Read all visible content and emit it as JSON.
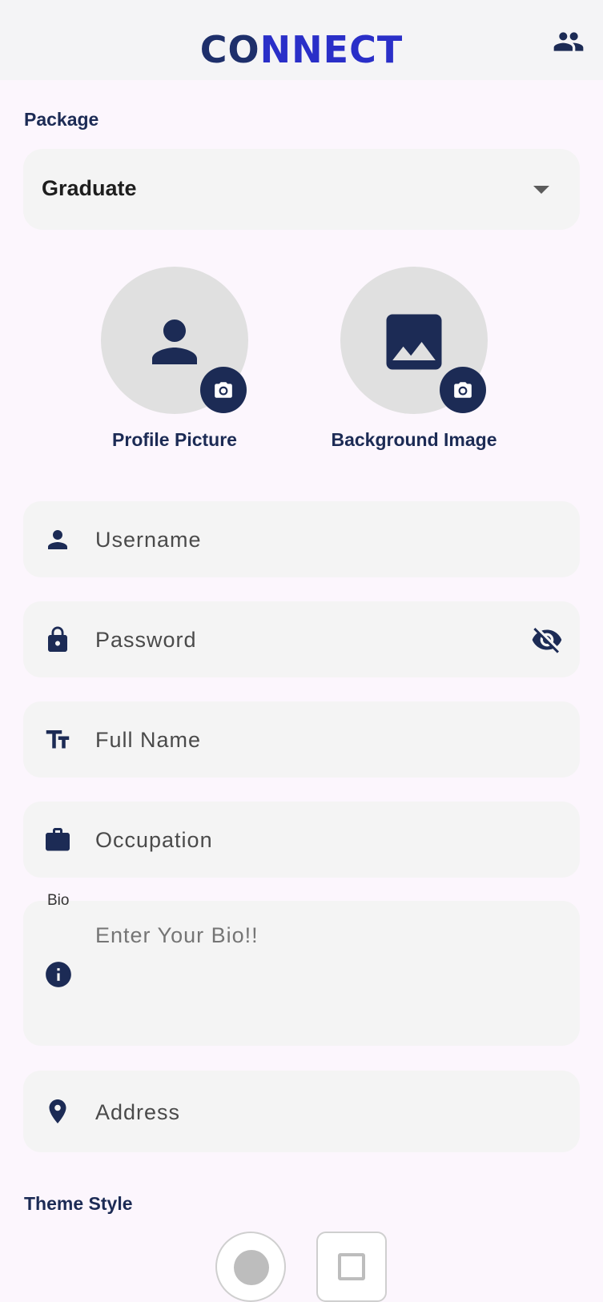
{
  "header": {
    "logo_dark": "CO",
    "logo_mid": "NN",
    "logo_end": "ECT",
    "people_icon": "people-icon"
  },
  "package": {
    "label": "Package",
    "selected": "Graduate"
  },
  "media": {
    "profile_label": "Profile Picture",
    "background_label": "Background Image"
  },
  "fields": {
    "username_placeholder": "Username",
    "password_placeholder": "Password",
    "fullname_placeholder": "Full Name",
    "occupation_placeholder": "Occupation",
    "bio_label": "Bio",
    "bio_placeholder": "Enter Your Bio!!",
    "address_placeholder": "Address"
  },
  "theme": {
    "label": "Theme Style"
  },
  "colors": {
    "primary": "#1c2b55",
    "background": "#fcf6fd",
    "field": "#f4f4f4",
    "avatar_bg": "#e0e0e0"
  }
}
